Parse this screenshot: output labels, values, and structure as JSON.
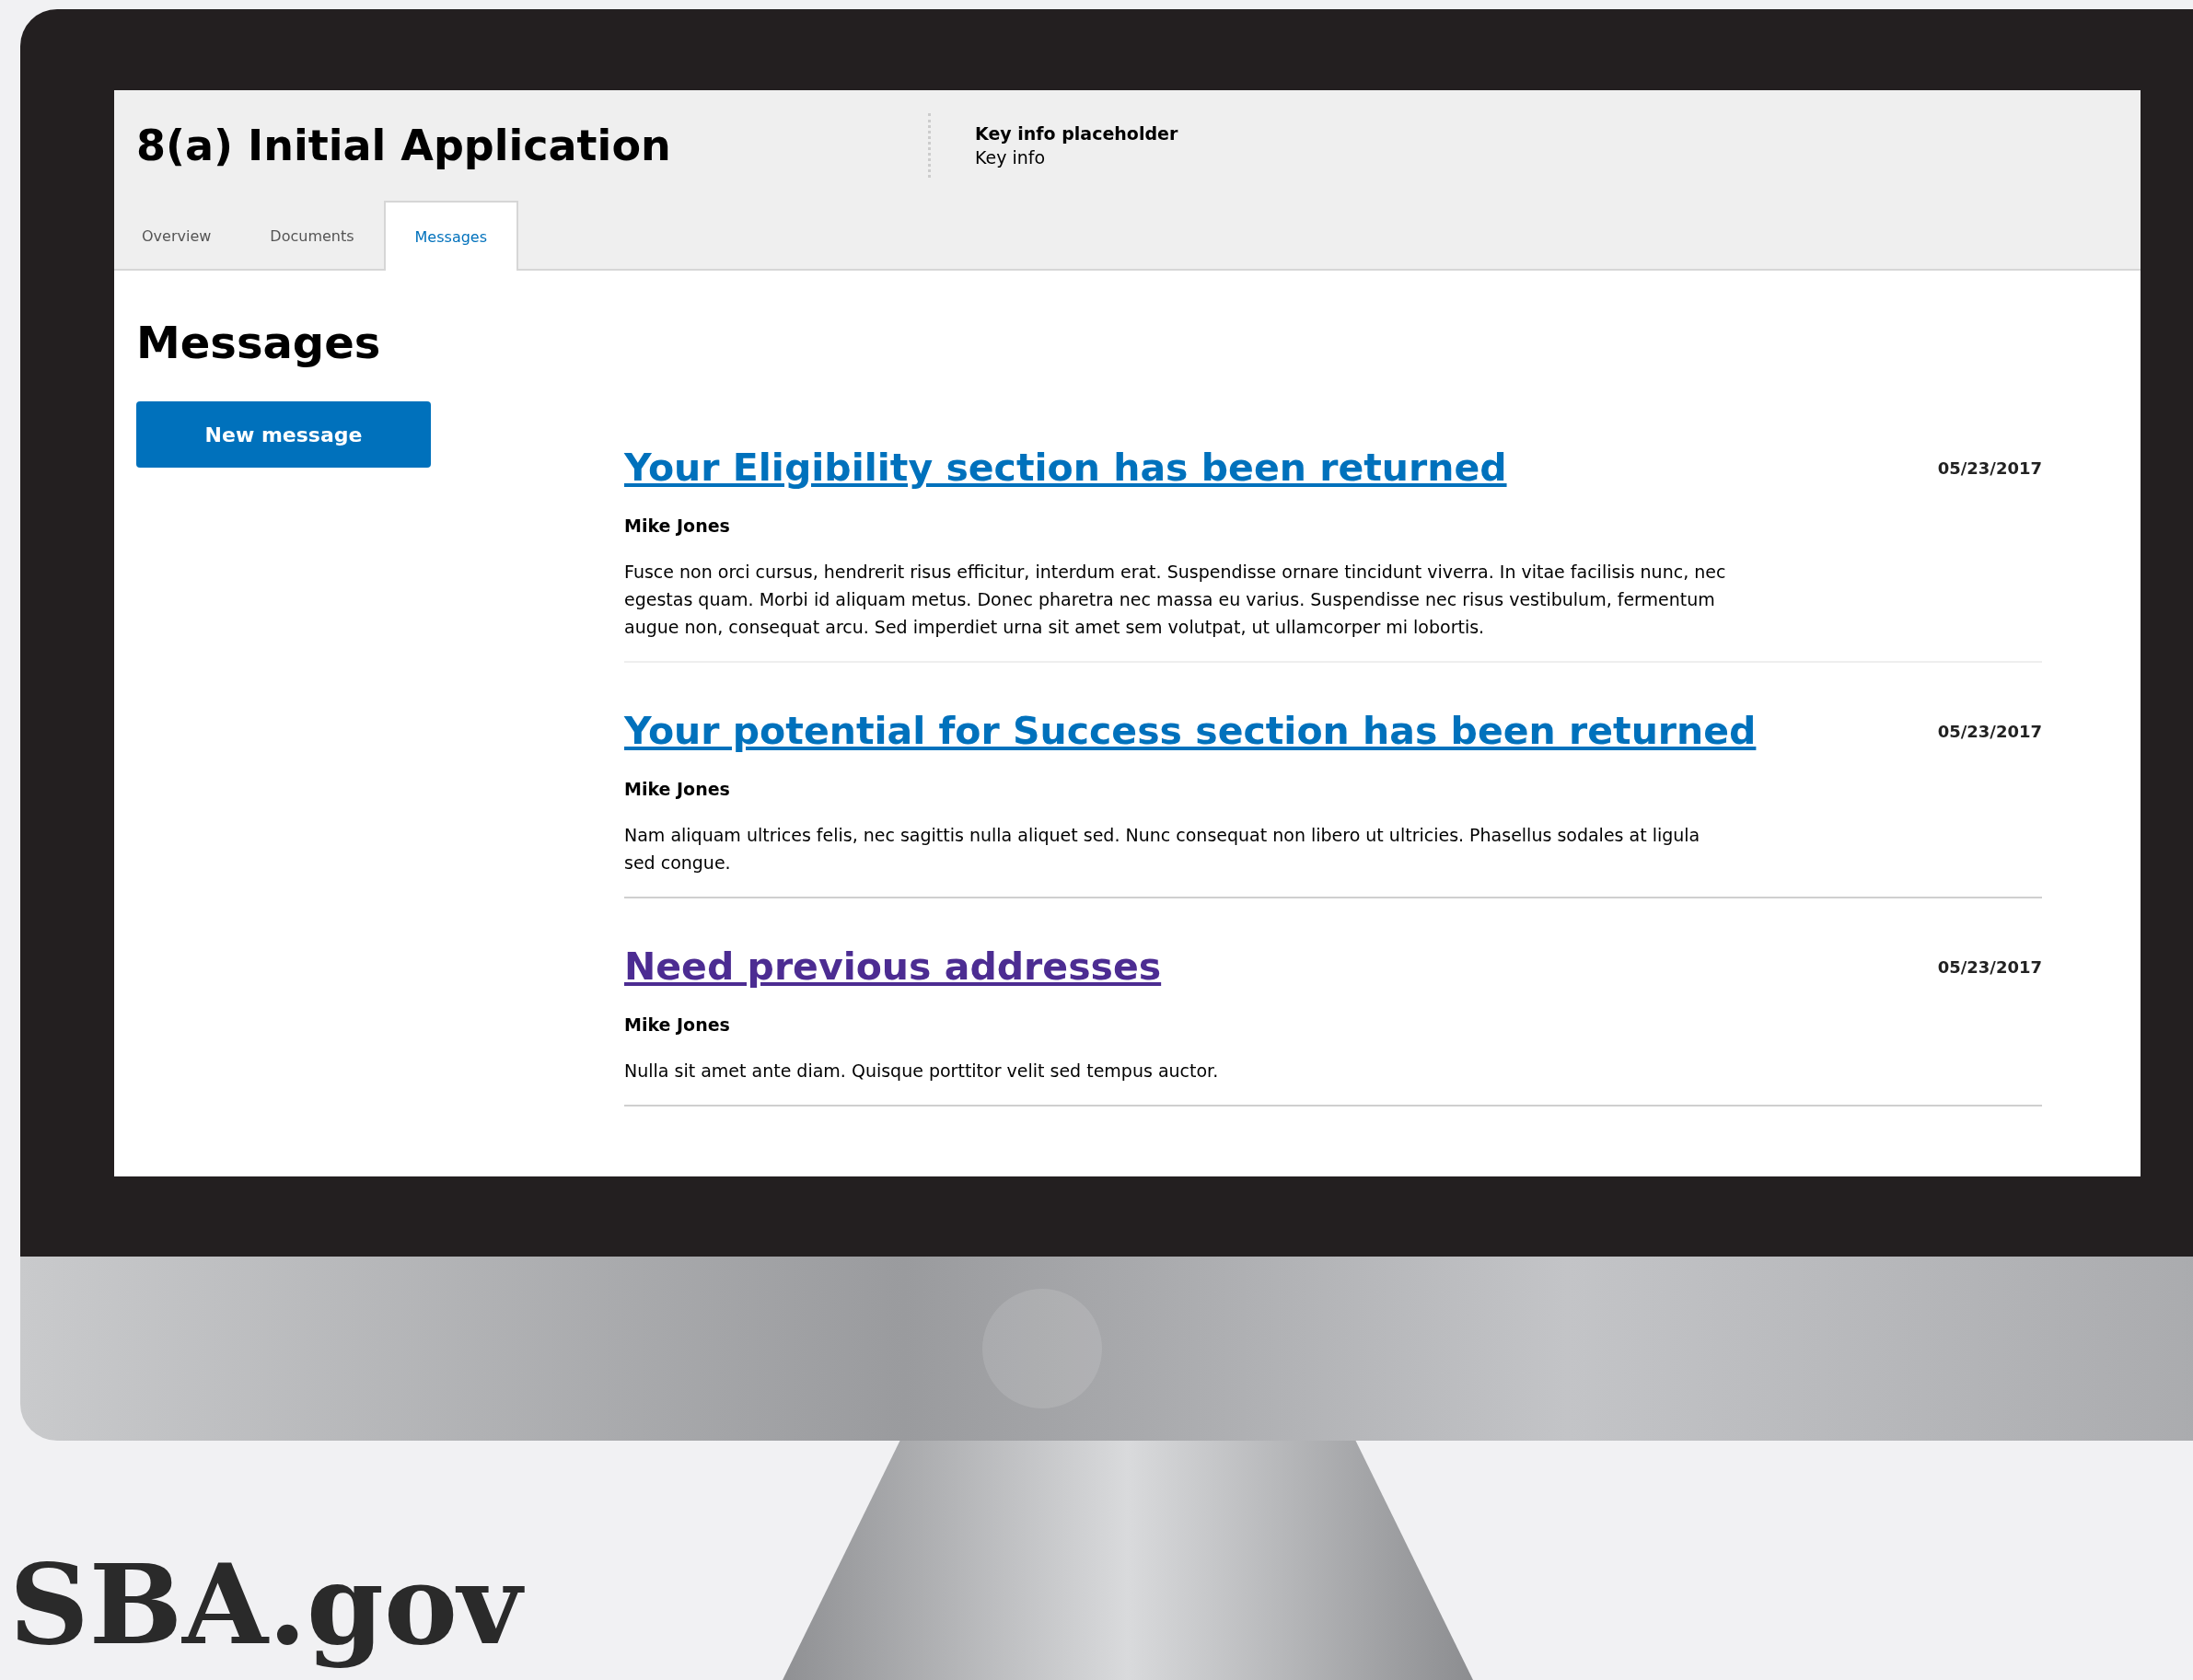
{
  "app": {
    "title": "8(a) Initial Application",
    "key_info": {
      "label": "Key info placeholder",
      "value": "Key info"
    }
  },
  "tabs": [
    {
      "label": "Overview",
      "selected": false
    },
    {
      "label": "Documents",
      "selected": false
    },
    {
      "label": "Messages",
      "selected": true
    }
  ],
  "page": {
    "heading": "Messages",
    "new_button": "New message"
  },
  "messages": [
    {
      "title": "Your Eligibility section has been returned",
      "visited": false,
      "date": "05/23/2017",
      "author": "Mike Jones",
      "body": "Fusce non orci cursus, hendrerit risus efficitur, interdum erat. Suspendisse ornare tincidunt viverra. In vitae facilisis nunc, nec egestas quam. Morbi id aliquam metus. Donec pharetra nec massa eu varius. Suspendisse nec risus vestibulum, fermentum augue non, consequat arcu. Sed imperdiet urna sit amet sem volutpat, ut ullamcorper mi lobortis."
    },
    {
      "title": "Your potential for Success section has been returned",
      "visited": false,
      "date": "05/23/2017",
      "author": "Mike Jones",
      "body": "Nam aliquam ultrices felis, nec sagittis nulla aliquet sed. Nunc consequat non libero ut ultricies. Phasellus sodales at ligula sed congue."
    },
    {
      "title": "Need previous addresses",
      "visited": true,
      "date": "05/23/2017",
      "author": "Mike Jones",
      "body": "Nulla sit amet ante diam. Quisque porttitor velit sed tempus auctor."
    }
  ],
  "footer": {
    "logo": "SBA.gov"
  }
}
